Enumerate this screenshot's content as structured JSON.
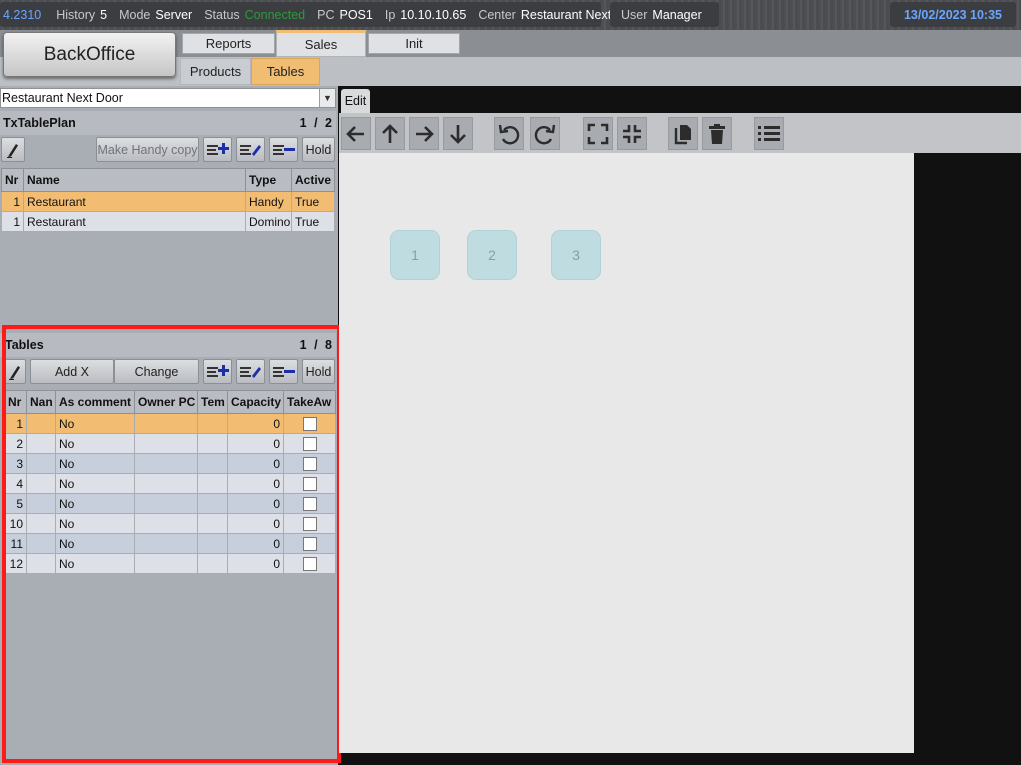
{
  "topbar": {
    "version": "4.2310",
    "history_label": "History",
    "history_value": "5",
    "mode_label": "Mode",
    "mode_value": "Server",
    "status_label": "Status",
    "status_value": "Connected",
    "pc_label": "PC",
    "pc_value": "POS1",
    "ip_label": "Ip",
    "ip_value": "10.10.10.65",
    "center_label": "Center",
    "center_value": "Restaurant Next Door",
    "user_label": "User",
    "user_value": "Manager",
    "datetime": "13/02/2023 10:35"
  },
  "nav": {
    "backoffice": "BackOffice",
    "tabs": [
      {
        "label": "Reports",
        "active": false
      },
      {
        "label": "Sales",
        "active": true
      },
      {
        "label": "Init",
        "active": false
      }
    ],
    "subtabs": [
      {
        "label": "Products",
        "active": false
      },
      {
        "label": "Tables",
        "active": true
      }
    ]
  },
  "center_select": {
    "value": "Restaurant Next Door"
  },
  "tableplan": {
    "title": "TxTablePlan",
    "pager": "1 / 2",
    "buttons": {
      "make_handy_copy": "Make Handy copy",
      "hold": "Hold"
    },
    "columns": [
      "Nr",
      "Name",
      "Type",
      "Active"
    ],
    "rows": [
      {
        "nr": "1",
        "name": "Restaurant",
        "type": "Handy",
        "active": "True"
      },
      {
        "nr": "1",
        "name": "Restaurant",
        "type": "Domino",
        "active": "True"
      }
    ]
  },
  "tables": {
    "title": "Tables",
    "pager": "1 / 8",
    "buttons": {
      "add_x": "Add X",
      "change": "Change",
      "hold": "Hold"
    },
    "columns": [
      "Nr",
      "Nan",
      "As comment",
      "Owner PC",
      "Tem",
      "Capacity",
      "TakeAw"
    ],
    "rows": [
      {
        "nr": "1",
        "nan": "",
        "as_comment": "No",
        "owner_pc": "",
        "tem": "",
        "capacity": "0",
        "takeaway": false
      },
      {
        "nr": "2",
        "nan": "",
        "as_comment": "No",
        "owner_pc": "",
        "tem": "",
        "capacity": "0",
        "takeaway": false
      },
      {
        "nr": "3",
        "nan": "",
        "as_comment": "No",
        "owner_pc": "",
        "tem": "",
        "capacity": "0",
        "takeaway": false
      },
      {
        "nr": "4",
        "nan": "",
        "as_comment": "No",
        "owner_pc": "",
        "tem": "",
        "capacity": "0",
        "takeaway": false
      },
      {
        "nr": "5",
        "nan": "",
        "as_comment": "No",
        "owner_pc": "",
        "tem": "",
        "capacity": "0",
        "takeaway": false
      },
      {
        "nr": "10",
        "nan": "",
        "as_comment": "No",
        "owner_pc": "",
        "tem": "",
        "capacity": "0",
        "takeaway": false
      },
      {
        "nr": "11",
        "nan": "",
        "as_comment": "No",
        "owner_pc": "",
        "tem": "",
        "capacity": "0",
        "takeaway": false
      },
      {
        "nr": "12",
        "nan": "",
        "as_comment": "No",
        "owner_pc": "",
        "tem": "",
        "capacity": "0",
        "takeaway": false
      }
    ]
  },
  "editor": {
    "tab_label": "Edit",
    "toolbar_icons": [
      "arrow-left-icon",
      "arrow-up-icon",
      "arrow-right-icon",
      "arrow-down-icon",
      "undo-icon",
      "redo-icon",
      "expand-icon",
      "compress-icon",
      "copy-icon",
      "trash-icon",
      "list-icon"
    ],
    "table_blocks": [
      "1",
      "2",
      "3"
    ]
  },
  "colors": {
    "selected_row": "#f2bd72",
    "active_tab": "#f1bd72",
    "highlight_frame": "#ff1a1a",
    "table_block": "#bfdde0"
  }
}
